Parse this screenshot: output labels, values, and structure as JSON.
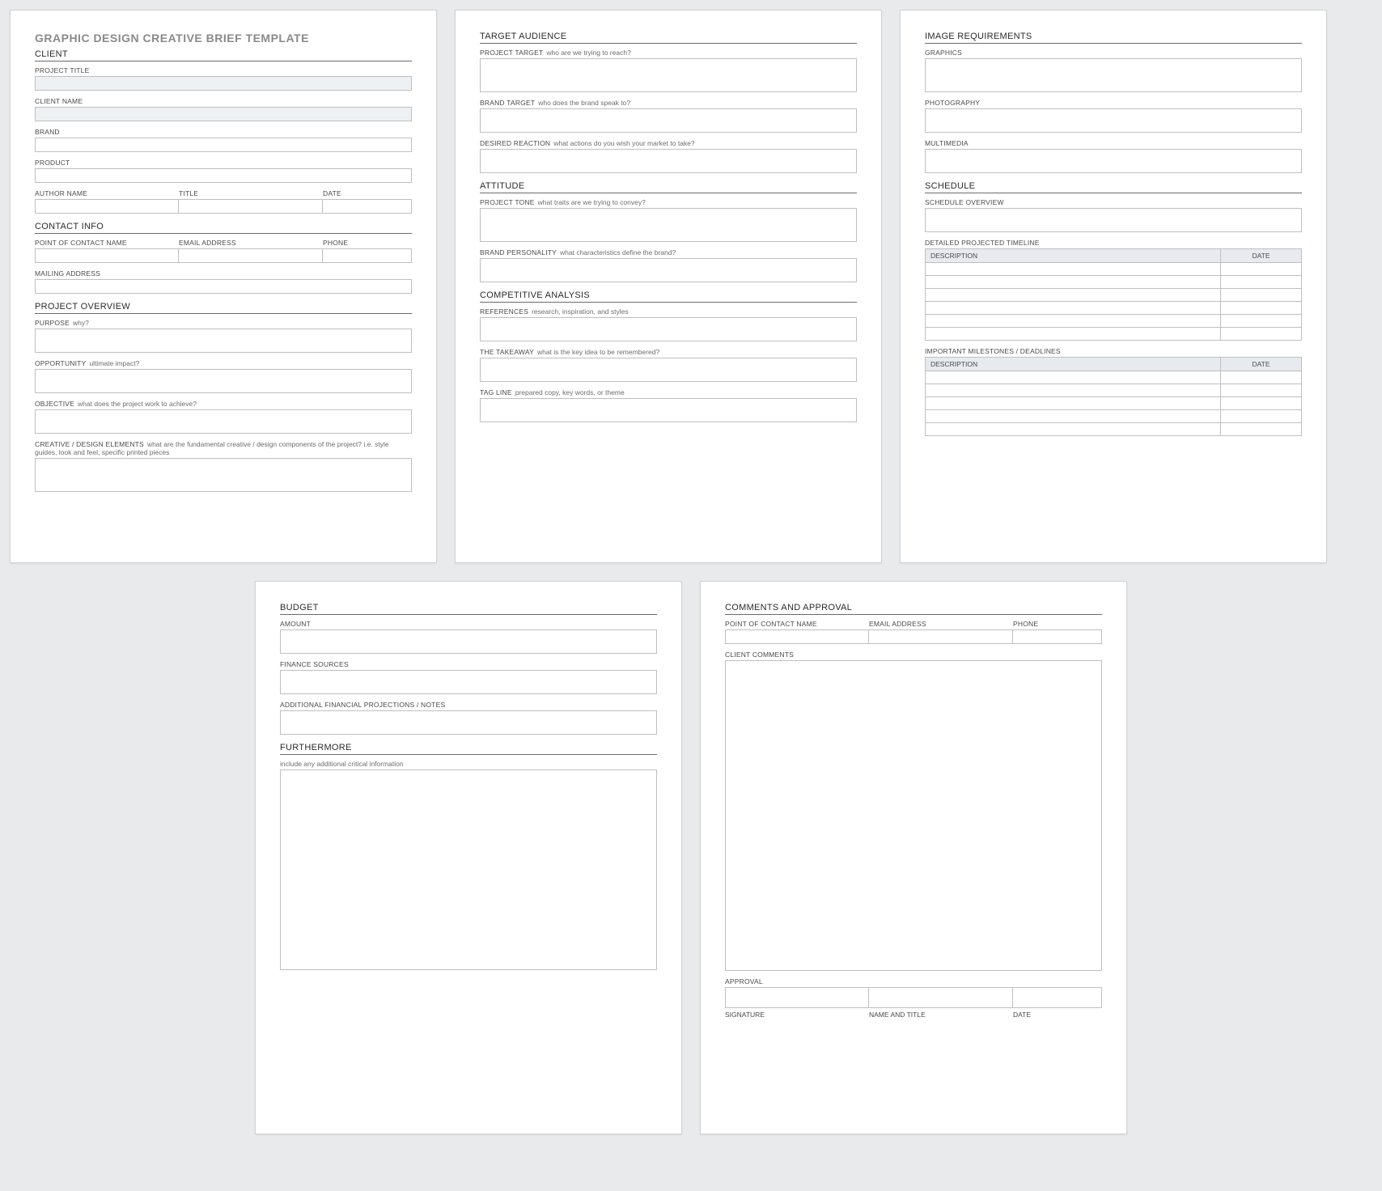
{
  "doc_title": "GRAPHIC DESIGN CREATIVE BRIEF TEMPLATE",
  "page1": {
    "client_h": "CLIENT",
    "project_title": "PROJECT TITLE",
    "client_name": "CLIENT NAME",
    "brand": "BRAND",
    "product": "PRODUCT",
    "author_name": "AUTHOR NAME",
    "title": "TITLE",
    "date": "DATE",
    "contact_h": "CONTACT INFO",
    "poc": "POINT OF CONTACT NAME",
    "email": "EMAIL ADDRESS",
    "phone": "PHONE",
    "mailing": "MAILING ADDRESS",
    "overview_h": "PROJECT OVERVIEW",
    "purpose": "PURPOSE",
    "purpose_hint": "why?",
    "opportunity": "OPPORTUNITY",
    "opportunity_hint": "ultimate impact?",
    "objective": "OBJECTIVE",
    "objective_hint": "what does the project work to achieve?",
    "creative": "CREATIVE / DESIGN ELEMENTS",
    "creative_hint": "what are the fundamental creative / design components of the project? i.e. style guides, look and feel, specific printed pieces"
  },
  "page2": {
    "audience_h": "TARGET AUDIENCE",
    "target": "PROJECT TARGET",
    "target_hint": "who are we trying to reach?",
    "brand_target": "BRAND TARGET",
    "brand_target_hint": "who does the brand speak to?",
    "reaction": "DESIRED REACTION",
    "reaction_hint": "what actions do you wish your market to take?",
    "attitude_h": "ATTITUDE",
    "tone": "PROJECT TONE",
    "tone_hint": "what traits are we trying to convey?",
    "personality": "BRAND PERSONALITY",
    "personality_hint": "what characteristics define the brand?",
    "competitive_h": "COMPETITIVE ANALYSIS",
    "references": "REFERENCES",
    "references_hint": "research, inspiration, and styles",
    "takeaway": "THE TAKEAWAY",
    "takeaway_hint": "what is the key idea to be remembered?",
    "tagline": "TAG LINE",
    "tagline_hint": "prepared copy, key words, or theme"
  },
  "page3": {
    "image_h": "IMAGE REQUIREMENTS",
    "graphics": "GRAPHICS",
    "photography": "PHOTOGRAPHY",
    "multimedia": "MULTIMEDIA",
    "schedule_h": "SCHEDULE",
    "schedule_overview": "SCHEDULE OVERVIEW",
    "timeline": "DETAILED PROJECTED TIMELINE",
    "milestones": "IMPORTANT MILESTONES / DEADLINES",
    "th_desc": "DESCRIPTION",
    "th_date": "DATE"
  },
  "page4": {
    "budget_h": "BUDGET",
    "amount": "AMOUNT",
    "finance": "FINANCE SOURCES",
    "additional": "ADDITIONAL FINANCIAL PROJECTIONS / NOTES",
    "furthermore_h": "FURTHERMORE",
    "furthermore_hint": "include any additional critical information"
  },
  "page5": {
    "comments_h": "COMMENTS AND APPROVAL",
    "poc": "POINT OF CONTACT NAME",
    "email": "EMAIL ADDRESS",
    "phone": "PHONE",
    "client_comments": "CLIENT COMMENTS",
    "approval": "APPROVAL",
    "signature": "SIGNATURE",
    "name_title": "NAME AND TITLE",
    "date": "DATE"
  }
}
